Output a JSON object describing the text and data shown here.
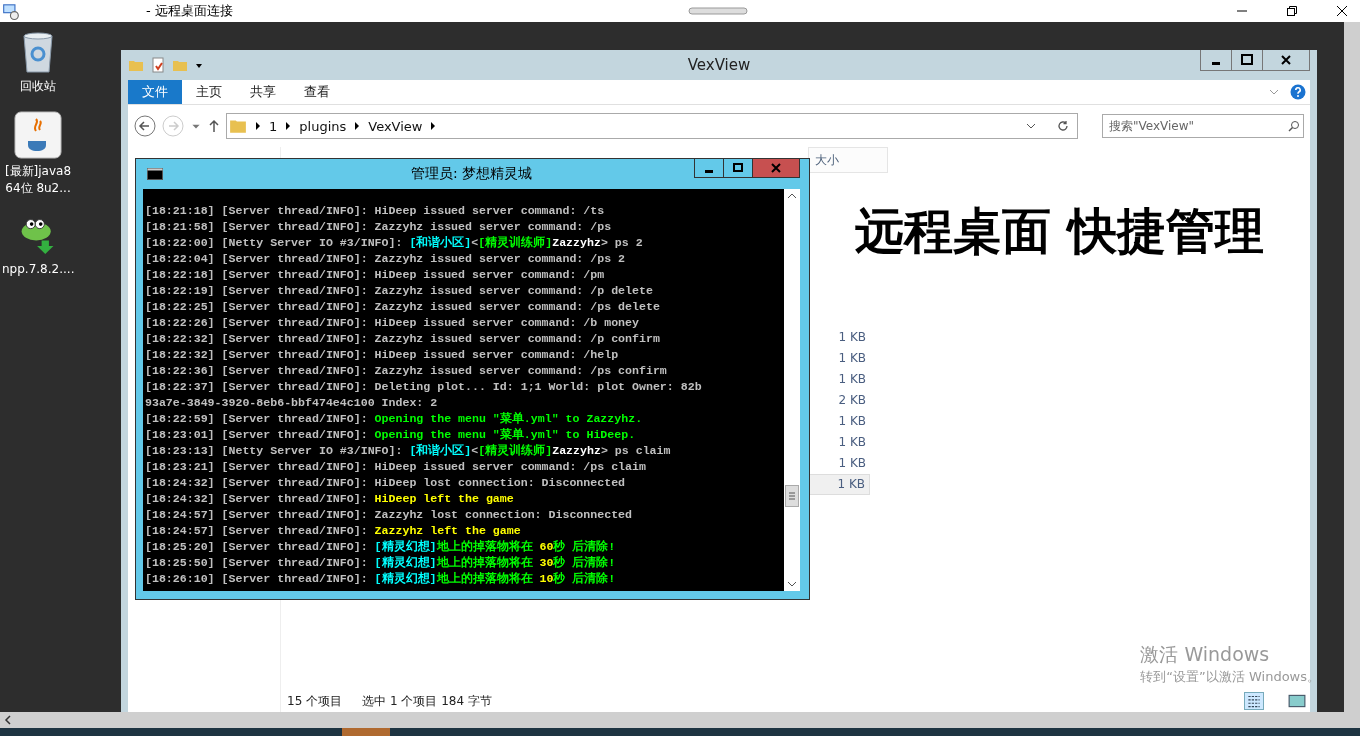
{
  "rdp": {
    "title": "- 远程桌面连接"
  },
  "desktop_icons": [
    {
      "kind": "bin",
      "label": "回收站"
    },
    {
      "kind": "java",
      "label": "[最新]java8 64位 8u2..."
    },
    {
      "kind": "npp",
      "label": "npp.7.8.2...."
    }
  ],
  "explorer": {
    "title": "VexView",
    "ribbon_tabs": [
      {
        "label": "文件",
        "selected": true
      },
      {
        "label": "主页",
        "selected": false
      },
      {
        "label": "共享",
        "selected": false
      },
      {
        "label": "查看",
        "selected": false
      }
    ],
    "breadcrumb": [
      "1",
      "plugins",
      "VexView"
    ],
    "search": {
      "placeholder": "搜索\"VexView\""
    },
    "columns": [
      "大小"
    ],
    "sizes": [
      {
        "text": "1 KB",
        "selected": false
      },
      {
        "text": "1 KB",
        "selected": false
      },
      {
        "text": "1 KB",
        "selected": false
      },
      {
        "text": "2 KB",
        "selected": false
      },
      {
        "text": "1 KB",
        "selected": false
      },
      {
        "text": "1 KB",
        "selected": false
      },
      {
        "text": "1 KB",
        "selected": false
      },
      {
        "text": "1 KB",
        "selected": true
      }
    ],
    "banner": "远程桌面 快捷管理",
    "status": [
      "15 个项目",
      "选中 1 个项目  184 字节"
    ]
  },
  "console": {
    "title": "管理员: 梦想精灵城",
    "lines": [
      [
        {
          "text": "[18:21:18] [Server thread/INFO]: HiDeep issued server command: /ts",
          "color": "#c0c0c0"
        }
      ],
      [
        {
          "text": "[18:21:58] [Server thread/INFO]: Zazzyhz issued server command: /ps",
          "color": "#c0c0c0"
        }
      ],
      [
        {
          "text": "[18:22:00] [Netty Server IO #3/INFO]: ",
          "color": "#c0c0c0"
        },
        {
          "text": "[和谐小区]",
          "color": "#00ffff"
        },
        {
          "text": "<",
          "color": "#c0c0c0"
        },
        {
          "text": "[精灵训练师]",
          "color": "#00ff00"
        },
        {
          "text": "Zazzyhz",
          "color": "#ffffff"
        },
        {
          "text": "> ps 2",
          "color": "#c0c0c0"
        }
      ],
      [
        {
          "text": "[18:22:04] [Server thread/INFO]: Zazzyhz issued server command: /ps 2",
          "color": "#c0c0c0"
        }
      ],
      [
        {
          "text": "[18:22:18] [Server thread/INFO]: HiDeep issued server command: /pm",
          "color": "#c0c0c0"
        }
      ],
      [
        {
          "text": "[18:22:19] [Server thread/INFO]: Zazzyhz issued server command: /p delete",
          "color": "#c0c0c0"
        }
      ],
      [
        {
          "text": "[18:22:25] [Server thread/INFO]: Zazzyhz issued server command: /ps delete",
          "color": "#c0c0c0"
        }
      ],
      [
        {
          "text": "[18:22:26] [Server thread/INFO]: HiDeep issued server command: /b money",
          "color": "#c0c0c0"
        }
      ],
      [
        {
          "text": "[18:22:32] [Server thread/INFO]: Zazzyhz issued server command: /p confirm",
          "color": "#c0c0c0"
        }
      ],
      [
        {
          "text": "[18:22:32] [Server thread/INFO]: HiDeep issued server command: /help",
          "color": "#c0c0c0"
        }
      ],
      [
        {
          "text": "[18:22:36] [Server thread/INFO]: Zazzyhz issued server command: /ps confirm",
          "color": "#c0c0c0"
        }
      ],
      [
        {
          "text": "[18:22:37] [Server thread/INFO]: Deleting plot... Id: 1;1 World: plot Owner: 82b",
          "color": "#c0c0c0"
        }
      ],
      [
        {
          "text": "93a7e-3849-3920-8eb6-bbf474e4c100 Index: 2",
          "color": "#c0c0c0"
        }
      ],
      [
        {
          "text": "[18:22:59] [Server thread/INFO]: ",
          "color": "#c0c0c0"
        },
        {
          "text": "Opening the menu \"菜单.yml\" to Zazzyhz.",
          "color": "#00ff00"
        }
      ],
      [
        {
          "text": "[18:23:01] [Server thread/INFO]: ",
          "color": "#c0c0c0"
        },
        {
          "text": "Opening the menu \"菜单.yml\" to HiDeep.",
          "color": "#00ff00"
        }
      ],
      [
        {
          "text": "[18:23:13] [Netty Server IO #3/INFO]: ",
          "color": "#c0c0c0"
        },
        {
          "text": "[和谐小区]",
          "color": "#00ffff"
        },
        {
          "text": "<",
          "color": "#c0c0c0"
        },
        {
          "text": "[精灵训练师]",
          "color": "#00ff00"
        },
        {
          "text": "Zazzyhz",
          "color": "#ffffff"
        },
        {
          "text": "> ps claim",
          "color": "#c0c0c0"
        }
      ],
      [
        {
          "text": "[18:23:21] [Server thread/INFO]: HiDeep issued server command: /ps claim",
          "color": "#c0c0c0"
        }
      ],
      [
        {
          "text": "[18:24:32] [Server thread/INFO]: HiDeep lost connection: Disconnected",
          "color": "#c0c0c0"
        }
      ],
      [
        {
          "text": "[18:24:32] [Server thread/INFO]: ",
          "color": "#c0c0c0"
        },
        {
          "text": "HiDeep left the game",
          "color": "#ffff00"
        }
      ],
      [
        {
          "text": "[18:24:57] [Server thread/INFO]: Zazzyhz lost connection: Disconnected",
          "color": "#c0c0c0"
        }
      ],
      [
        {
          "text": "[18:24:57] [Server thread/INFO]: ",
          "color": "#c0c0c0"
        },
        {
          "text": "Zazzyhz left the game",
          "color": "#ffff00"
        }
      ],
      [
        {
          "text": "[18:25:20] [Server thread/INFO]: ",
          "color": "#c0c0c0"
        },
        {
          "text": "[精灵幻想]",
          "color": "#00ffff"
        },
        {
          "text": "地上的掉落物将在 ",
          "color": "#00ff00"
        },
        {
          "text": "60",
          "color": "#ffff00"
        },
        {
          "text": "秒 后清除!",
          "color": "#00ff00"
        }
      ],
      [
        {
          "text": "[18:25:50] [Server thread/INFO]: ",
          "color": "#c0c0c0"
        },
        {
          "text": "[精灵幻想]",
          "color": "#00ffff"
        },
        {
          "text": "地上的掉落物将在 ",
          "color": "#00ff00"
        },
        {
          "text": "30",
          "color": "#ffff00"
        },
        {
          "text": "秒 后清除!",
          "color": "#00ff00"
        }
      ],
      [
        {
          "text": "[18:26:10] [Server thread/INFO]: ",
          "color": "#c0c0c0"
        },
        {
          "text": "[精灵幻想]",
          "color": "#00ffff"
        },
        {
          "text": "地上的掉落物将在 ",
          "color": "#00ff00"
        },
        {
          "text": "10",
          "color": "#ffff00"
        },
        {
          "text": "秒 后清除!",
          "color": "#00ff00"
        }
      ]
    ]
  },
  "activation": {
    "title": "激活 Windows",
    "hint": "转到“设置”以激活 Windows。"
  }
}
